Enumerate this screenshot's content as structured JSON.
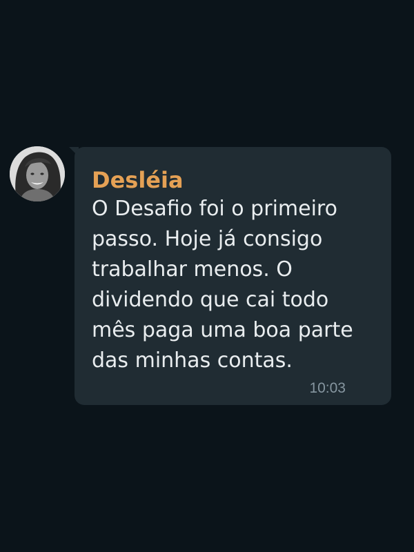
{
  "chat": {
    "contact_avatar_icon": "avatar-photo",
    "message": {
      "sender": "Desléia",
      "lines": [
        "O Desafio foi o primeiro",
        "passo. Hoje já consigo",
        "trabalhar menos. O",
        "dividendo que cai todo",
        "mês paga uma boa parte",
        "das minhas contas."
      ],
      "time": "10:03"
    }
  },
  "colors": {
    "background": "#0b141a",
    "bubble": "#202c33",
    "sender_name": "#e5a155",
    "message_text": "#e9edef",
    "timestamp": "#8696a0"
  }
}
